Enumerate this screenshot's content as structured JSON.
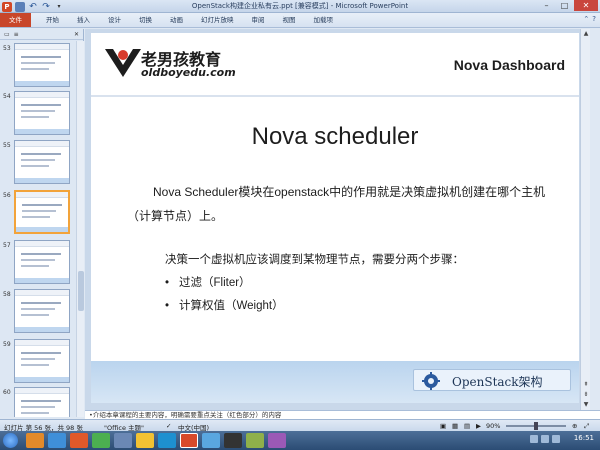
{
  "window": {
    "title": "OpenStack构建企业私有云.ppt [兼容模式] - Microsoft PowerPoint",
    "controls": [
      "–",
      "□",
      "✕"
    ]
  },
  "ribbon": {
    "tabs": [
      "文件",
      "开始",
      "插入",
      "设计",
      "切换",
      "动画",
      "幻灯片放映",
      "审阅",
      "视图",
      "加载项"
    ],
    "active_tab": "开始"
  },
  "pane": {
    "thumbnails": [
      {
        "num": "53"
      },
      {
        "num": "54"
      },
      {
        "num": "55"
      },
      {
        "num": "56"
      },
      {
        "num": "57"
      },
      {
        "num": "58"
      },
      {
        "num": "59"
      },
      {
        "num": "60"
      }
    ],
    "selected": "56"
  },
  "slide": {
    "logo_cn": "老男孩教育",
    "logo_en": "oldboyedu.com",
    "header_title": "Nova Dashboard",
    "title": "Nova scheduler",
    "paragraph": "Nova Scheduler模块在openstack中的作用就是决策虚拟机创建在哪个主机（计算节点）上。",
    "steps_intro": "决策一个虚拟机应该调度到某物理节点，需要分两个步骤：",
    "bullets": [
      "过滤（Fliter）",
      "计算权值（Weight）"
    ],
    "footer_badge": "OpenStack架构"
  },
  "notes": {
    "text": "•介绍本章课程的主要内容，明确需要重点关注（红色部分）的内容"
  },
  "status": {
    "slide_info": "幻灯片 第 56 张，共 98 张",
    "theme": "\"Office 主题\"",
    "language": "中文(中国)",
    "zoom": "90%"
  },
  "taskbar": {
    "clock": "16:51"
  },
  "colors": {
    "file_tab": "#c8462a",
    "footer": "#bad4ee",
    "selected_thumb": "#f2a33a"
  }
}
